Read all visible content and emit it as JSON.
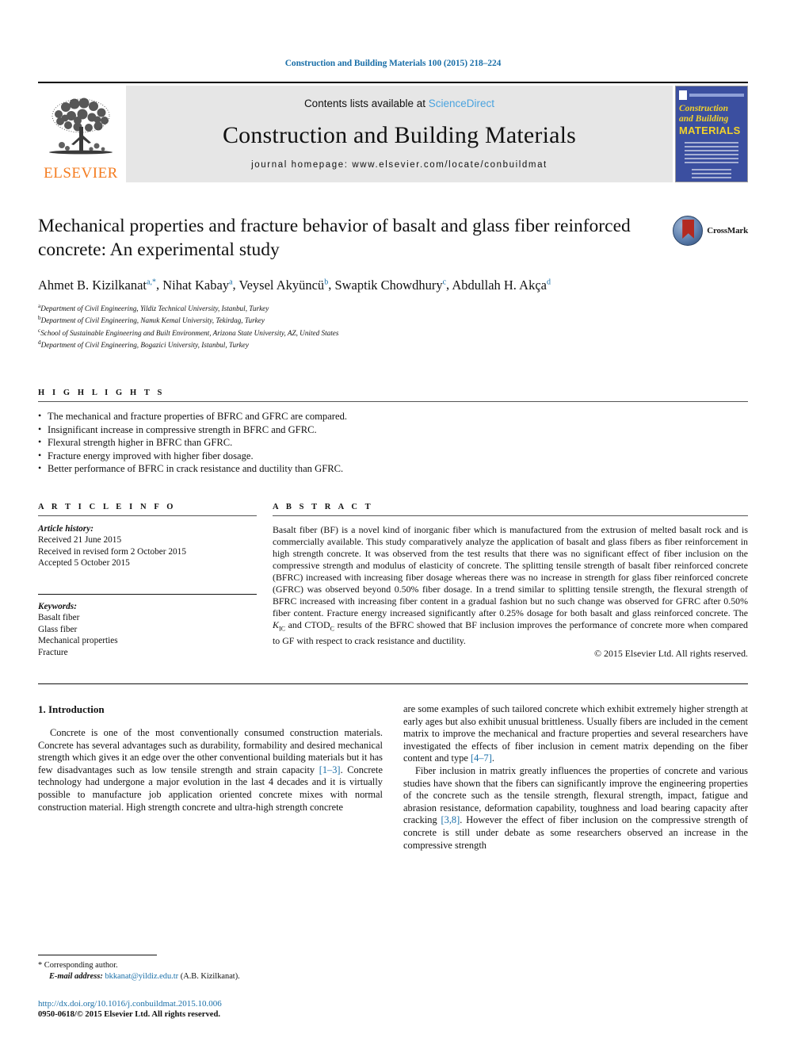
{
  "running_head": "Construction and Building Materials 100 (2015) 218–224",
  "masthead": {
    "publisher_name": "ELSEVIER",
    "contents_prefix": "Contents lists available at ",
    "contents_link": "ScienceDirect",
    "journal_title": "Construction and Building Materials",
    "homepage": "journal homepage: www.elsevier.com/locate/conbuildmat",
    "cover": {
      "line1": "Construction",
      "line2": "and Building",
      "line3": "MATERIALS"
    }
  },
  "article": {
    "title": "Mechanical properties and fracture behavior of basalt and glass fiber reinforced concrete: An experimental study",
    "crossmark_label": "CrossMark",
    "authors": [
      {
        "name": "Ahmet B. Kizilkanat",
        "marks": "a,*"
      },
      {
        "name": "Nihat Kabay",
        "marks": "a"
      },
      {
        "name": "Veysel Akyüncü",
        "marks": "b"
      },
      {
        "name": "Swaptik Chowdhury",
        "marks": "c"
      },
      {
        "name": "Abdullah H. Akça",
        "marks": "d"
      }
    ],
    "affiliations": [
      {
        "mark": "a",
        "text": "Department of Civil Engineering, Yildiz Technical University, Istanbul, Turkey"
      },
      {
        "mark": "b",
        "text": "Department of Civil Engineering, Namık Kemal University, Tekirdag, Turkey"
      },
      {
        "mark": "c",
        "text": "School of Sustainable Engineering and Built Environment, Arizona State University, AZ, United States"
      },
      {
        "mark": "d",
        "text": "Department of Civil Engineering, Bogazici University, Istanbul, Turkey"
      }
    ]
  },
  "highlights": {
    "heading": "H I G H L I G H T S",
    "items": [
      "The mechanical and fracture properties of BFRC and GFRC are compared.",
      "Insignificant increase in compressive strength in BFRC and GFRC.",
      "Flexural strength higher in BFRC than GFRC.",
      "Fracture energy improved with higher fiber dosage.",
      "Better performance of BFRC in crack resistance and ductility than GFRC."
    ]
  },
  "article_info": {
    "heading": "A R T I C L E    I N F O",
    "history_title": "Article history:",
    "history": [
      "Received 21 June 2015",
      "Received in revised form 2 October 2015",
      "Accepted 5 October 2015"
    ],
    "keywords_title": "Keywords:",
    "keywords": [
      "Basalt fiber",
      "Glass fiber",
      "Mechanical properties",
      "Fracture"
    ]
  },
  "abstract": {
    "heading": "A B S T R A C T",
    "part1": "Basalt fiber (BF) is a novel kind of inorganic fiber which is manufactured from the extrusion of melted basalt rock and is commercially available. This study comparatively analyze the application of basalt and glass fibers as fiber reinforcement in high strength concrete. It was observed from the test results that there was no significant effect of fiber inclusion on the compressive strength and modulus of elasticity of concrete. The splitting tensile strength of basalt fiber reinforced concrete (BFRC) increased with increasing fiber dosage whereas there was no increase in strength for glass fiber reinforced concrete (GFRC) was observed beyond 0.50% fiber dosage. In a trend similar to splitting tensile strength, the flexural strength of BFRC increased with increasing fiber content in a gradual fashion but no such change was observed for GFRC after 0.50% fiber content. Fracture energy increased significantly after 0.25% dosage for both basalt and glass reinforced concrete. The ",
    "kic": "K",
    "kic_sub": "IC",
    "mid": " and CTOD",
    "ctod_sub": "C",
    "part2": " results of the BFRC showed that BF inclusion improves the performance of concrete more when compared to GF with respect to crack resistance and ductility.",
    "copyright": "© 2015 Elsevier Ltd. All rights reserved."
  },
  "body": {
    "section_heading": "1. Introduction",
    "left_p1_a": "Concrete is one of the most conventionally consumed construction materials. Concrete has several advantages such as durability, formability and desired mechanical strength which gives it an edge over the other conventional building materials but it has few disadvantages such as low tensile strength and strain capacity ",
    "left_ref1": "[1–3]",
    "left_p1_b": ". Concrete technology had undergone a major evolution in the last 4 decades and it is virtually possible to manufacture job application oriented concrete mixes with normal construction material. High strength concrete and ultra-high strength concrete",
    "right_p1_a": "are some examples of such tailored concrete which exhibit extremely higher strength at early ages but also exhibit unusual brittleness. Usually fibers are included in the cement matrix to improve the mechanical and fracture properties and several researchers have investigated the effects of fiber inclusion in cement matrix depending on the fiber content and type ",
    "right_ref1": "[4–7]",
    "right_p1_b": ".",
    "right_p2_a": "Fiber inclusion in matrix greatly influences the properties of concrete and various studies have shown that the fibers can significantly improve the engineering properties of the concrete such as the tensile strength, flexural strength, impact, fatigue and abrasion resistance, deformation capability, toughness and load bearing capacity after cracking ",
    "right_ref2": "[3,8]",
    "right_p2_b": ". However the effect of fiber inclusion on the compressive strength of concrete is still under debate as some researchers observed an increase in the compressive strength"
  },
  "footnote": {
    "corresponding": "Corresponding author.",
    "email_label": "E-mail address:",
    "email": "bkkanat@yildiz.edu.tr",
    "email_owner": "(A.B. Kizilkanat).",
    "doi": "http://dx.doi.org/10.1016/j.conbuildmat.2015.10.006",
    "issn_a": "0950-0618/",
    "issn_b": "© 2015 Elsevier Ltd. All rights reserved."
  },
  "colors": {
    "link": "#1a6fa8",
    "elsevier_orange": "#F47C20",
    "band_gray": "#e6e6e6",
    "cover_blue": "#3b4fa0",
    "cover_yellow": "#f2d22a"
  }
}
